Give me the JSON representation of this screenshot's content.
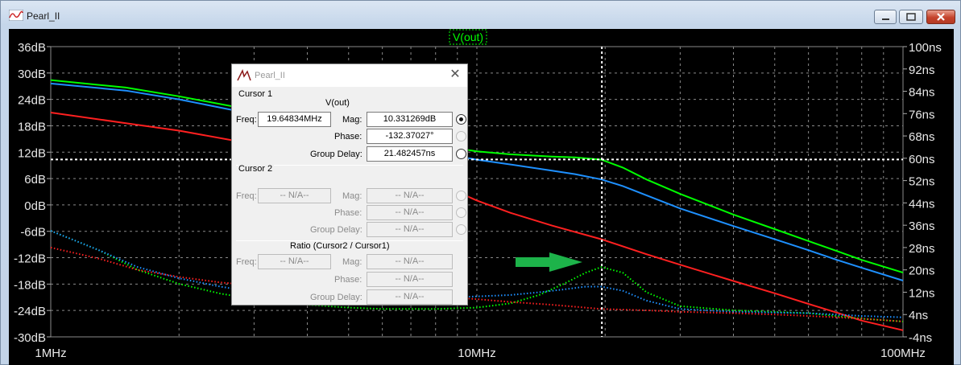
{
  "window": {
    "title": "Pearl_II"
  },
  "plot": {
    "trace_label": "V(out)",
    "trace_label_color": "#00ff00",
    "left_ticks": [
      "36dB",
      "30dB",
      "24dB",
      "18dB",
      "12dB",
      "6dB",
      "0dB",
      "-6dB",
      "-12dB",
      "-18dB",
      "-24dB",
      "-30dB"
    ],
    "right_ticks": [
      "100ns",
      "92ns",
      "84ns",
      "76ns",
      "68ns",
      "60ns",
      "52ns",
      "44ns",
      "36ns",
      "28ns",
      "20ns",
      "12ns",
      "4ns",
      "-4ns"
    ],
    "x_ticks": [
      "1MHz",
      "10MHz",
      "100MHz"
    ],
    "arrow_color": "#1db34a"
  },
  "chart_data": {
    "type": "line",
    "x_scale": "log",
    "x_range_hz": [
      1000000,
      100000000
    ],
    "y_left_range_db": [
      -30,
      36
    ],
    "y_right_range_ns": [
      -4,
      100
    ],
    "grid": true,
    "cursor": {
      "freq_hz": 19648340,
      "mag_db": 10.331269
    },
    "series": [
      {
        "axis": "left",
        "color": "#00ff00",
        "style": "solid",
        "points": [
          [
            1,
            28.4
          ],
          [
            1.5,
            26.7
          ],
          [
            2,
            24.7
          ],
          [
            3,
            21.5
          ],
          [
            4,
            19.2
          ],
          [
            5,
            17.3
          ],
          [
            6,
            15.8
          ],
          [
            8,
            13.6
          ],
          [
            10,
            12.2
          ],
          [
            12,
            11.5
          ],
          [
            15,
            11.0
          ],
          [
            17,
            10.8
          ],
          [
            19.6,
            10.3
          ],
          [
            22,
            8.5
          ],
          [
            25,
            5.8
          ],
          [
            30,
            2.5
          ],
          [
            40,
            -2.2
          ],
          [
            50,
            -5.5
          ],
          [
            60,
            -8.2
          ],
          [
            70,
            -10.5
          ],
          [
            80,
            -12.5
          ],
          [
            100,
            -15.4
          ]
        ]
      },
      {
        "axis": "left",
        "color": "#1e90ff",
        "style": "solid",
        "points": [
          [
            1,
            27.6
          ],
          [
            1.5,
            26.0
          ],
          [
            2,
            24.0
          ],
          [
            3,
            20.6
          ],
          [
            4,
            18.2
          ],
          [
            5,
            16.1
          ],
          [
            6,
            14.5
          ],
          [
            8,
            12.0
          ],
          [
            10,
            10.3
          ],
          [
            12,
            9.2
          ],
          [
            15,
            7.8
          ],
          [
            17,
            7.0
          ],
          [
            19.6,
            5.8
          ],
          [
            22,
            4.3
          ],
          [
            25,
            2.2
          ],
          [
            30,
            -0.8
          ],
          [
            40,
            -4.8
          ],
          [
            50,
            -7.8
          ],
          [
            60,
            -10.3
          ],
          [
            70,
            -12.5
          ],
          [
            80,
            -14.3
          ],
          [
            100,
            -17.2
          ]
        ]
      },
      {
        "axis": "left",
        "color": "#ff2020",
        "style": "solid",
        "points": [
          [
            1,
            21.0
          ],
          [
            1.5,
            18.6
          ],
          [
            2,
            16.9
          ],
          [
            3,
            13.8
          ],
          [
            4,
            11.6
          ],
          [
            5,
            9.6
          ],
          [
            6,
            8.0
          ],
          [
            8,
            5.2
          ],
          [
            10,
            1.0
          ],
          [
            12,
            -1.8
          ],
          [
            15,
            -4.7
          ],
          [
            19.6,
            -7.8
          ],
          [
            25,
            -11.2
          ],
          [
            30,
            -13.6
          ],
          [
            40,
            -17.3
          ],
          [
            50,
            -20.1
          ],
          [
            60,
            -22.5
          ],
          [
            70,
            -24.5
          ],
          [
            80,
            -26.3
          ],
          [
            100,
            -28.5
          ]
        ]
      },
      {
        "axis": "right",
        "color": "#00ff00",
        "style": "dotted",
        "points": [
          [
            1,
            34
          ],
          [
            1.3,
            27
          ],
          [
            1.6,
            20
          ],
          [
            2,
            15
          ],
          [
            2.5,
            11.5
          ],
          [
            3,
            9.5
          ],
          [
            4,
            7.5
          ],
          [
            5,
            6.5
          ],
          [
            6,
            6
          ],
          [
            8,
            6
          ],
          [
            10,
            6.5
          ],
          [
            12,
            8
          ],
          [
            14,
            11
          ],
          [
            16,
            15
          ],
          [
            18,
            19
          ],
          [
            19.6,
            21
          ],
          [
            22,
            19
          ],
          [
            25,
            12
          ],
          [
            30,
            7
          ],
          [
            40,
            5.5
          ],
          [
            60,
            4.5
          ],
          [
            80,
            2.5
          ],
          [
            100,
            1.5
          ]
        ]
      },
      {
        "axis": "right",
        "color": "#1e90ff",
        "style": "dotted",
        "points": [
          [
            1,
            34
          ],
          [
            1.3,
            27
          ],
          [
            1.6,
            21
          ],
          [
            2,
            17
          ],
          [
            2.5,
            14
          ],
          [
            3,
            12
          ],
          [
            4,
            10
          ],
          [
            5,
            9.5
          ],
          [
            6,
            9.5
          ],
          [
            8,
            10
          ],
          [
            10,
            10.5
          ],
          [
            12,
            11
          ],
          [
            14,
            12
          ],
          [
            16,
            13
          ],
          [
            18,
            14
          ],
          [
            19.6,
            14
          ],
          [
            22,
            12.5
          ],
          [
            25,
            9
          ],
          [
            30,
            6
          ],
          [
            40,
            5
          ],
          [
            60,
            4.5
          ],
          [
            80,
            3.5
          ],
          [
            100,
            3
          ]
        ]
      },
      {
        "axis": "right",
        "color": "#ff2020",
        "style": "dotted",
        "points": [
          [
            1,
            28
          ],
          [
            1.3,
            24
          ],
          [
            1.6,
            20
          ],
          [
            2,
            17.5
          ],
          [
            2.5,
            15.5
          ],
          [
            3,
            14.5
          ],
          [
            4,
            13.5
          ],
          [
            5,
            12.5
          ],
          [
            6,
            11.5
          ],
          [
            8,
            10.5
          ],
          [
            10,
            9.5
          ],
          [
            12,
            8.5
          ],
          [
            15,
            7.5
          ],
          [
            19.6,
            6
          ],
          [
            25,
            5.5
          ],
          [
            30,
            5
          ],
          [
            40,
            4.5
          ],
          [
            50,
            4
          ],
          [
            60,
            3.5
          ],
          [
            70,
            3
          ],
          [
            80,
            2.5
          ],
          [
            100,
            1.5
          ]
        ]
      }
    ]
  },
  "dialog": {
    "title": "Pearl_II",
    "cursor1_label": "Cursor 1",
    "trace": "V(out)",
    "freq_label": "Freq:",
    "freq_value": "19.64834MHz",
    "mag_label": "Mag:",
    "mag_value": "10.331269dB",
    "phase_label": "Phase:",
    "phase_value": "-132.37027°",
    "group_delay_label": "Group Delay:",
    "group_delay_value": "21.482457ns",
    "cursor2_label": "Cursor 2",
    "na": "-- N/A--",
    "ratio_label": "Ratio (Cursor2 / Cursor1)"
  }
}
